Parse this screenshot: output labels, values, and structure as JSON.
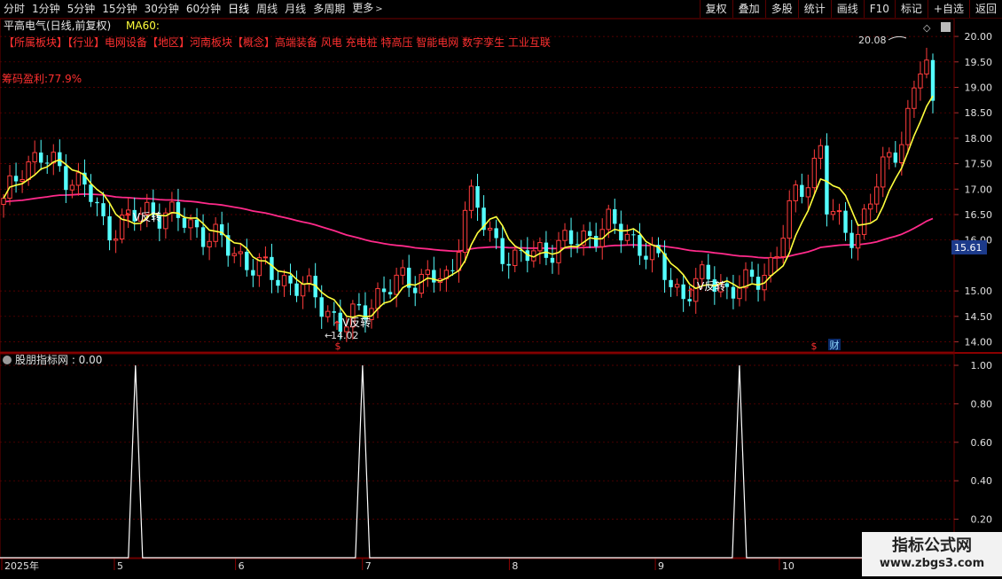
{
  "period_tabs": [
    "分时",
    "1分钟",
    "5分钟",
    "15分钟",
    "30分钟",
    "60分钟",
    "日线",
    "周线",
    "月线",
    "多周期",
    "更多"
  ],
  "active_tab": 6,
  "toolbar": [
    "复权",
    "叠加",
    "多股",
    "统计",
    "画线",
    "F10",
    "标记",
    "+自选",
    "返回"
  ],
  "main_panel": {
    "title": "平高电气(日线,前复权)",
    "indicator": "MA60:",
    "tags_line": "【所属板块】【行业】电网设备【地区】河南板块【概念】高端装备 风电 充电桩 特高压 智能电网 数字孪生 工业互联",
    "chip_profit": "筹码盈利:77.9%",
    "high_label": "20.08",
    "low_label": "14.02",
    "current_price": "15.61",
    "reversal_label": "V反转",
    "finance_label": "财",
    "dollar_label": "$",
    "price_ticks": [
      "20.00",
      "19.50",
      "19.00",
      "18.50",
      "18.00",
      "17.50",
      "17.00",
      "16.50",
      "16.00",
      "15.00",
      "14.50",
      "14.00"
    ]
  },
  "sub_panel": {
    "title": "股朋指标网 : 0.00",
    "ticks": [
      "1.00",
      "0.80",
      "0.60",
      "0.40",
      "0.20"
    ]
  },
  "time_axis": [
    "2025年",
    "5",
    "6",
    "7",
    "8",
    "9",
    "10"
  ],
  "colors": {
    "up": "#ff3c3c",
    "down": "#54ffff",
    "ma_short": "#ffff3c",
    "ma60": "#ff2a8a",
    "tag_text": "#ff3030",
    "grid": "#6e0000"
  },
  "watermark": {
    "title": "指标公式网",
    "url": "www.zbgs3.com"
  },
  "chart_data": {
    "type": "candlestick",
    "price_range": [
      13.8,
      20.35
    ],
    "signal_range": [
      0,
      1.06
    ],
    "signal_peaks": [
      0.142,
      0.38,
      0.775
    ],
    "reversal_points": [
      0.142,
      0.38,
      0.775
    ]
  }
}
